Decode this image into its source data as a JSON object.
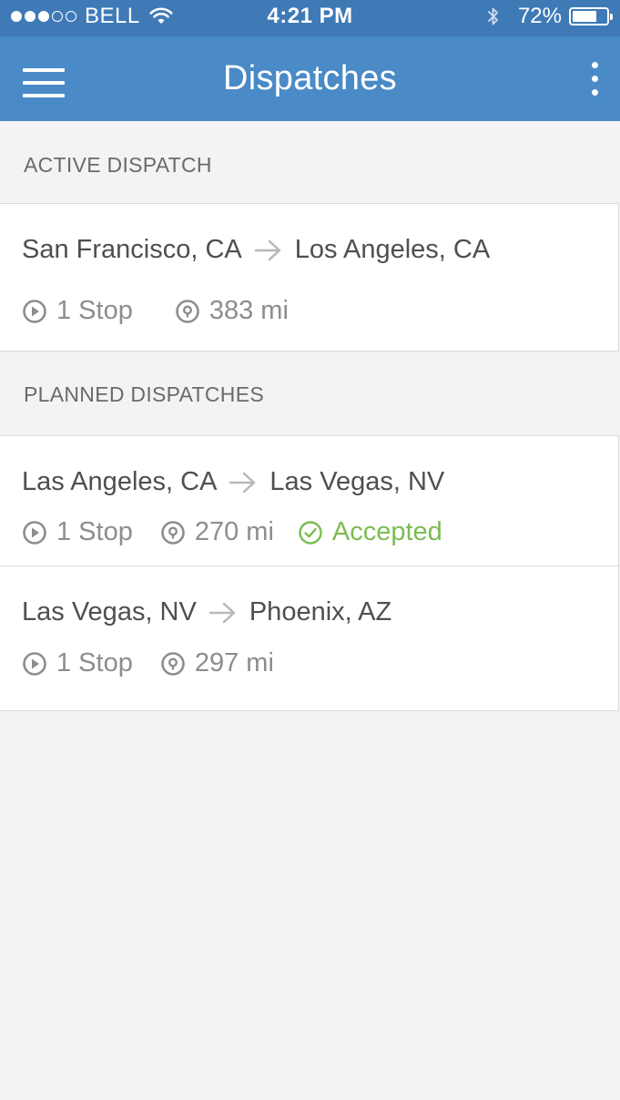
{
  "status_bar": {
    "carrier": "BELL",
    "time": "4:21 PM",
    "battery_percent": "72%",
    "battery_level": 0.72,
    "signal_bars_filled": 3,
    "signal_bars_total": 5
  },
  "app_bar": {
    "title": "Dispatches",
    "menu_icon": "hamburger-menu-icon",
    "more_icon": "more-vertical-icon"
  },
  "active_section": {
    "header": "ACTIVE DISPATCH",
    "items": [
      {
        "origin": "San Francisco, CA",
        "destination": "Los Angeles, CA",
        "stops": "1 Stop",
        "distance": "383 mi"
      }
    ]
  },
  "planned_section": {
    "header": "PLANNED DISPATCHES",
    "items": [
      {
        "origin": "Las Angeles, CA",
        "destination": "Las Vegas, NV",
        "stops": "1 Stop",
        "distance": "270 mi",
        "status": "Accepted"
      },
      {
        "origin": "Las Vegas, NV",
        "destination": "Phoenix, AZ",
        "stops": "1 Stop",
        "distance": "297 mi"
      }
    ]
  },
  "colors": {
    "status_bar": "#3f7ab7",
    "app_bar": "#4a8ac6",
    "background": "#f3f3f3",
    "accepted": "#7cbc52",
    "meta_text": "#8d8d8d"
  }
}
